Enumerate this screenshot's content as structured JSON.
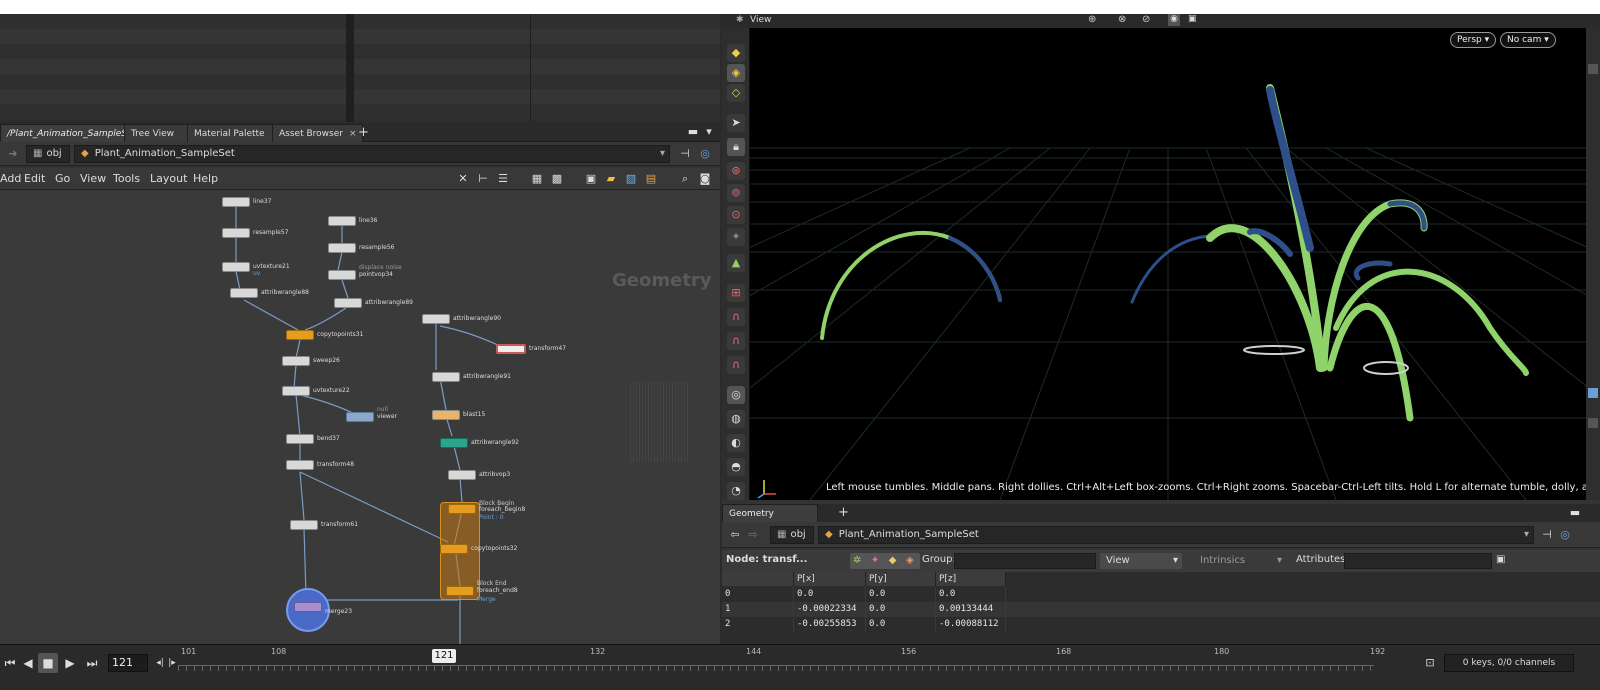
{
  "network": {
    "tabs": [
      {
        "label": "/Plant_Animation_SampleSet",
        "close": "×"
      },
      {
        "label": "Tree View",
        "close": "×"
      },
      {
        "label": "Material Palette",
        "close": "×"
      },
      {
        "label": "Asset Browser",
        "close": "×"
      }
    ],
    "add_tab": "+",
    "path": {
      "context": "obj",
      "object": "Plant_Animation_SampleSet"
    },
    "menu": [
      "Add",
      "Edit",
      "Go",
      "View",
      "Tools",
      "Layout",
      "Help"
    ],
    "context_label": "Geometry",
    "nodes": [
      {
        "name": "line37"
      },
      {
        "name": "resample57"
      },
      {
        "name": "uvtexture21",
        "sub": "uv"
      },
      {
        "name": "attribwrangle88"
      },
      {
        "name": "line36"
      },
      {
        "name": "resample56"
      },
      {
        "name": "pointvop34",
        "sub": "displace noise"
      },
      {
        "name": "attribwrangle89"
      },
      {
        "name": "copytopoints31"
      },
      {
        "name": "sweep26"
      },
      {
        "name": "uvtexture22"
      },
      {
        "name": "viewer",
        "sub": "null"
      },
      {
        "name": "bend37"
      },
      {
        "name": "transform48"
      },
      {
        "name": "transform61"
      },
      {
        "name": "merge23"
      },
      {
        "name": "attribwrangle90"
      },
      {
        "name": "transform47"
      },
      {
        "name": "attribwrangle91"
      },
      {
        "name": "blast15"
      },
      {
        "name": "attribwrangle92"
      },
      {
        "name": "attribvop3"
      },
      {
        "name": "foreach_begin8",
        "sub": "Point : 0"
      },
      {
        "name": "copytopoints32"
      },
      {
        "name": "foreach_end8",
        "sub": "Merge"
      }
    ],
    "block_label_begin": "Block Begin",
    "block_label_end": "Block End"
  },
  "viewport": {
    "title": "View",
    "persp_label": "Persp ▾",
    "cam_label": "No cam ▾",
    "hint": "Left mouse tumbles. Middle pans. Right dollies. Ctrl+Alt+Left box-zooms. Ctrl+Right zooms. Spacebar-Ctrl-Left tilts. Hold L for alternate tumble, dolly, and zoom."
  },
  "spreadsheet": {
    "tab_label": "Geometry Spreadsheet",
    "add_tab": "+",
    "path": {
      "context": "obj",
      "object": "Plant_Animation_SampleSet"
    },
    "node_label": "Node: transf...",
    "group_label": "Group:",
    "view_label": "View",
    "intrinsics_label": "Intrinsics",
    "attributes_label": "Attributes:",
    "columns": [
      "",
      "P[x]",
      "P[y]",
      "P[z]"
    ],
    "rows": [
      [
        "0",
        "0.0",
        "0.0",
        "0.0"
      ],
      [
        "1",
        "-0.00022334",
        "0.0",
        "0.00133444"
      ],
      [
        "2",
        "-0.00255853",
        "0.0",
        "-0.00088112"
      ]
    ]
  },
  "timeline": {
    "current_frame": "121",
    "marker": "121",
    "ticks": [
      "101",
      "108",
      "132",
      "144",
      "156",
      "168",
      "180",
      "192"
    ],
    "keys_label": "0 keys, 0/0 channels"
  },
  "colors": {
    "accent_orange": "#e69c1e",
    "teal": "#2ba58c",
    "wire": "#7a9cc6",
    "grass_green": "#8fd36a",
    "grass_blue": "#2f4f8a"
  }
}
